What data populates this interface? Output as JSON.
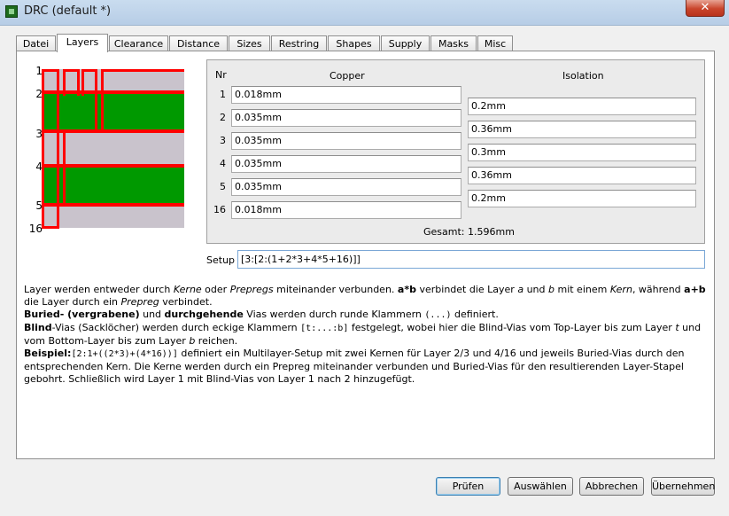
{
  "window": {
    "title": "DRC (default *)",
    "close_symbol": "✕"
  },
  "tabs": [
    {
      "label": "Datei",
      "active": false
    },
    {
      "label": "Layers",
      "active": true
    },
    {
      "label": "Clearance",
      "active": false
    },
    {
      "label": "Distance",
      "active": false
    },
    {
      "label": "Sizes",
      "active": false
    },
    {
      "label": "Restring",
      "active": false
    },
    {
      "label": "Shapes",
      "active": false
    },
    {
      "label": "Supply",
      "active": false
    },
    {
      "label": "Masks",
      "active": false
    },
    {
      "label": "Misc",
      "active": false
    }
  ],
  "stack_diagram": {
    "layer_numbers": [
      "1",
      "2",
      "3",
      "4",
      "5",
      "16"
    ],
    "colors": {
      "copper": "#ff0000",
      "core": "#009900",
      "prepreg": "#c9c3cc"
    }
  },
  "layers_table": {
    "col_nr": "Nr",
    "col_copper": "Copper",
    "col_isolation": "Isolation",
    "copper_rows": [
      {
        "nr": "1",
        "value": "0.018mm"
      },
      {
        "nr": "2",
        "value": "0.035mm"
      },
      {
        "nr": "3",
        "value": "0.035mm"
      },
      {
        "nr": "4",
        "value": "0.035mm"
      },
      {
        "nr": "5",
        "value": "0.035mm"
      },
      {
        "nr": "16",
        "value": "0.018mm"
      }
    ],
    "isolation_values": [
      "0.2mm",
      "0.36mm",
      "0.3mm",
      "0.36mm",
      "0.2mm"
    ],
    "total_label": "Gesamt:",
    "total_value": "1.596mm"
  },
  "setup": {
    "label": "Setup",
    "value": "[3:[2:(1+2*3+4*5+16)]]"
  },
  "help": {
    "p1": [
      {
        "t": "Layer werden entweder durch "
      },
      {
        "t": "Kerne",
        "i": true
      },
      {
        "t": " oder "
      },
      {
        "t": "Prepregs",
        "i": true
      },
      {
        "t": " miteinander verbunden. "
      },
      {
        "t": "a*b",
        "b": true
      },
      {
        "t": " verbindet die Layer "
      },
      {
        "t": "a",
        "i": true
      },
      {
        "t": " und "
      },
      {
        "t": "b",
        "i": true
      },
      {
        "t": " mit einem "
      },
      {
        "t": "Kern",
        "i": true
      },
      {
        "t": ", während "
      },
      {
        "t": "a+b",
        "b": true
      },
      {
        "t": " die Layer durch ein "
      },
      {
        "t": "Prepreg",
        "i": true
      },
      {
        "t": " verbindet."
      }
    ],
    "p2": [
      {
        "t": "Buried- (vergrabene)",
        "b": true
      },
      {
        "t": " und "
      },
      {
        "t": "durchgehende",
        "b": true
      },
      {
        "t": " Vias werden durch runde Klammern "
      },
      {
        "t": "(...)",
        "m": true
      },
      {
        "t": " definiert."
      }
    ],
    "p3": [
      {
        "t": "Blind",
        "b": true
      },
      {
        "t": "-Vias (Sacklöcher) werden durch eckige Klammern "
      },
      {
        "t": "[t:...:b]",
        "m": true
      },
      {
        "t": " festgelegt, wobei hier die Blind-Vias vom Top-Layer bis zum Layer "
      },
      {
        "t": "t",
        "i": true
      },
      {
        "t": " und vom Bottom-Layer bis zum Layer "
      },
      {
        "t": "b",
        "i": true
      },
      {
        "t": " reichen."
      }
    ],
    "p4": [
      {
        "t": "Beispiel:",
        "b": true
      },
      {
        "t": "[2:1+((2*3)+(4*16))]",
        "m": true
      },
      {
        "t": " definiert ein Multilayer-Setup mit zwei Kernen für Layer 2/3 und 4/16 und jeweils Buried-Vias durch den entsprechenden Kern. Die Kerne werden durch ein Prepreg miteinander verbunden und Buried-Vias für den resultierenden Layer-Stapel gebohrt. Schließlich wird Layer 1 mit Blind-Vias von Layer 1 nach 2 hinzugefügt."
      }
    ]
  },
  "buttons": {
    "apply": "Prüfen",
    "select": "Auswählen",
    "cancel": "Abbrechen",
    "ok": "Übernehmen"
  }
}
